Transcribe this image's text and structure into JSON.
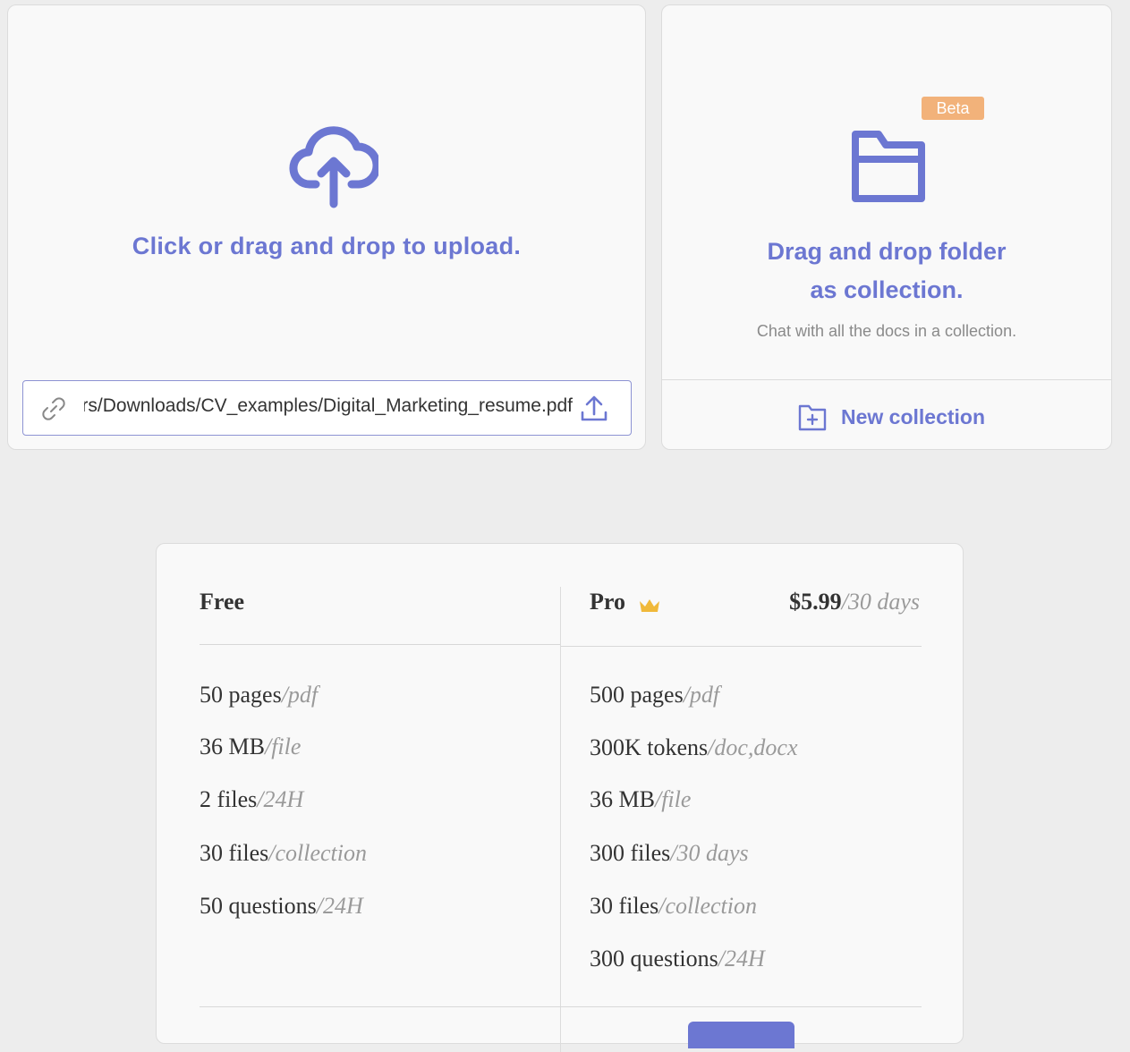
{
  "upload": {
    "title": "Click or drag and drop to upload.",
    "url_value": "C:/Users/Downloads/CV_examples/Digital_Marketing_resume.pdf",
    "icons": {
      "cloud": "cloud-upload-icon",
      "link": "link-icon",
      "submit": "upload-arrow-icon"
    }
  },
  "collection": {
    "badge": "Beta",
    "title_line1": "Drag and drop folder",
    "title_line2": "as collection.",
    "subtitle": "Chat with all the docs in a collection.",
    "new_label": "New collection",
    "icons": {
      "folder": "folder-icon",
      "new": "folder-plus-icon"
    }
  },
  "pricing": {
    "free": {
      "name": "Free",
      "features": [
        {
          "main": "50 pages",
          "unit": "/pdf"
        },
        {
          "main": "36 MB",
          "unit": "/file"
        },
        {
          "main": "2 files",
          "unit": "/24H"
        },
        {
          "main": "30 files",
          "unit": "/collection"
        },
        {
          "main": "50 questions",
          "unit": "/24H"
        }
      ]
    },
    "pro": {
      "name": "Pro",
      "price": "$5.99",
      "period": "/30 days",
      "icon": "crown-icon",
      "features": [
        {
          "main": "500 pages",
          "unit": "/pdf"
        },
        {
          "main": "300K tokens",
          "unit": "/doc,docx"
        },
        {
          "main": "36 MB",
          "unit": "/file"
        },
        {
          "main": "300 files",
          "unit": "/30 days"
        },
        {
          "main": "30 files",
          "unit": "/collection"
        },
        {
          "main": "300 questions",
          "unit": "/24H"
        }
      ]
    }
  },
  "colors": {
    "accent": "#6c77d2",
    "badge": "#f2b27a",
    "crown": "#f0b93a"
  }
}
